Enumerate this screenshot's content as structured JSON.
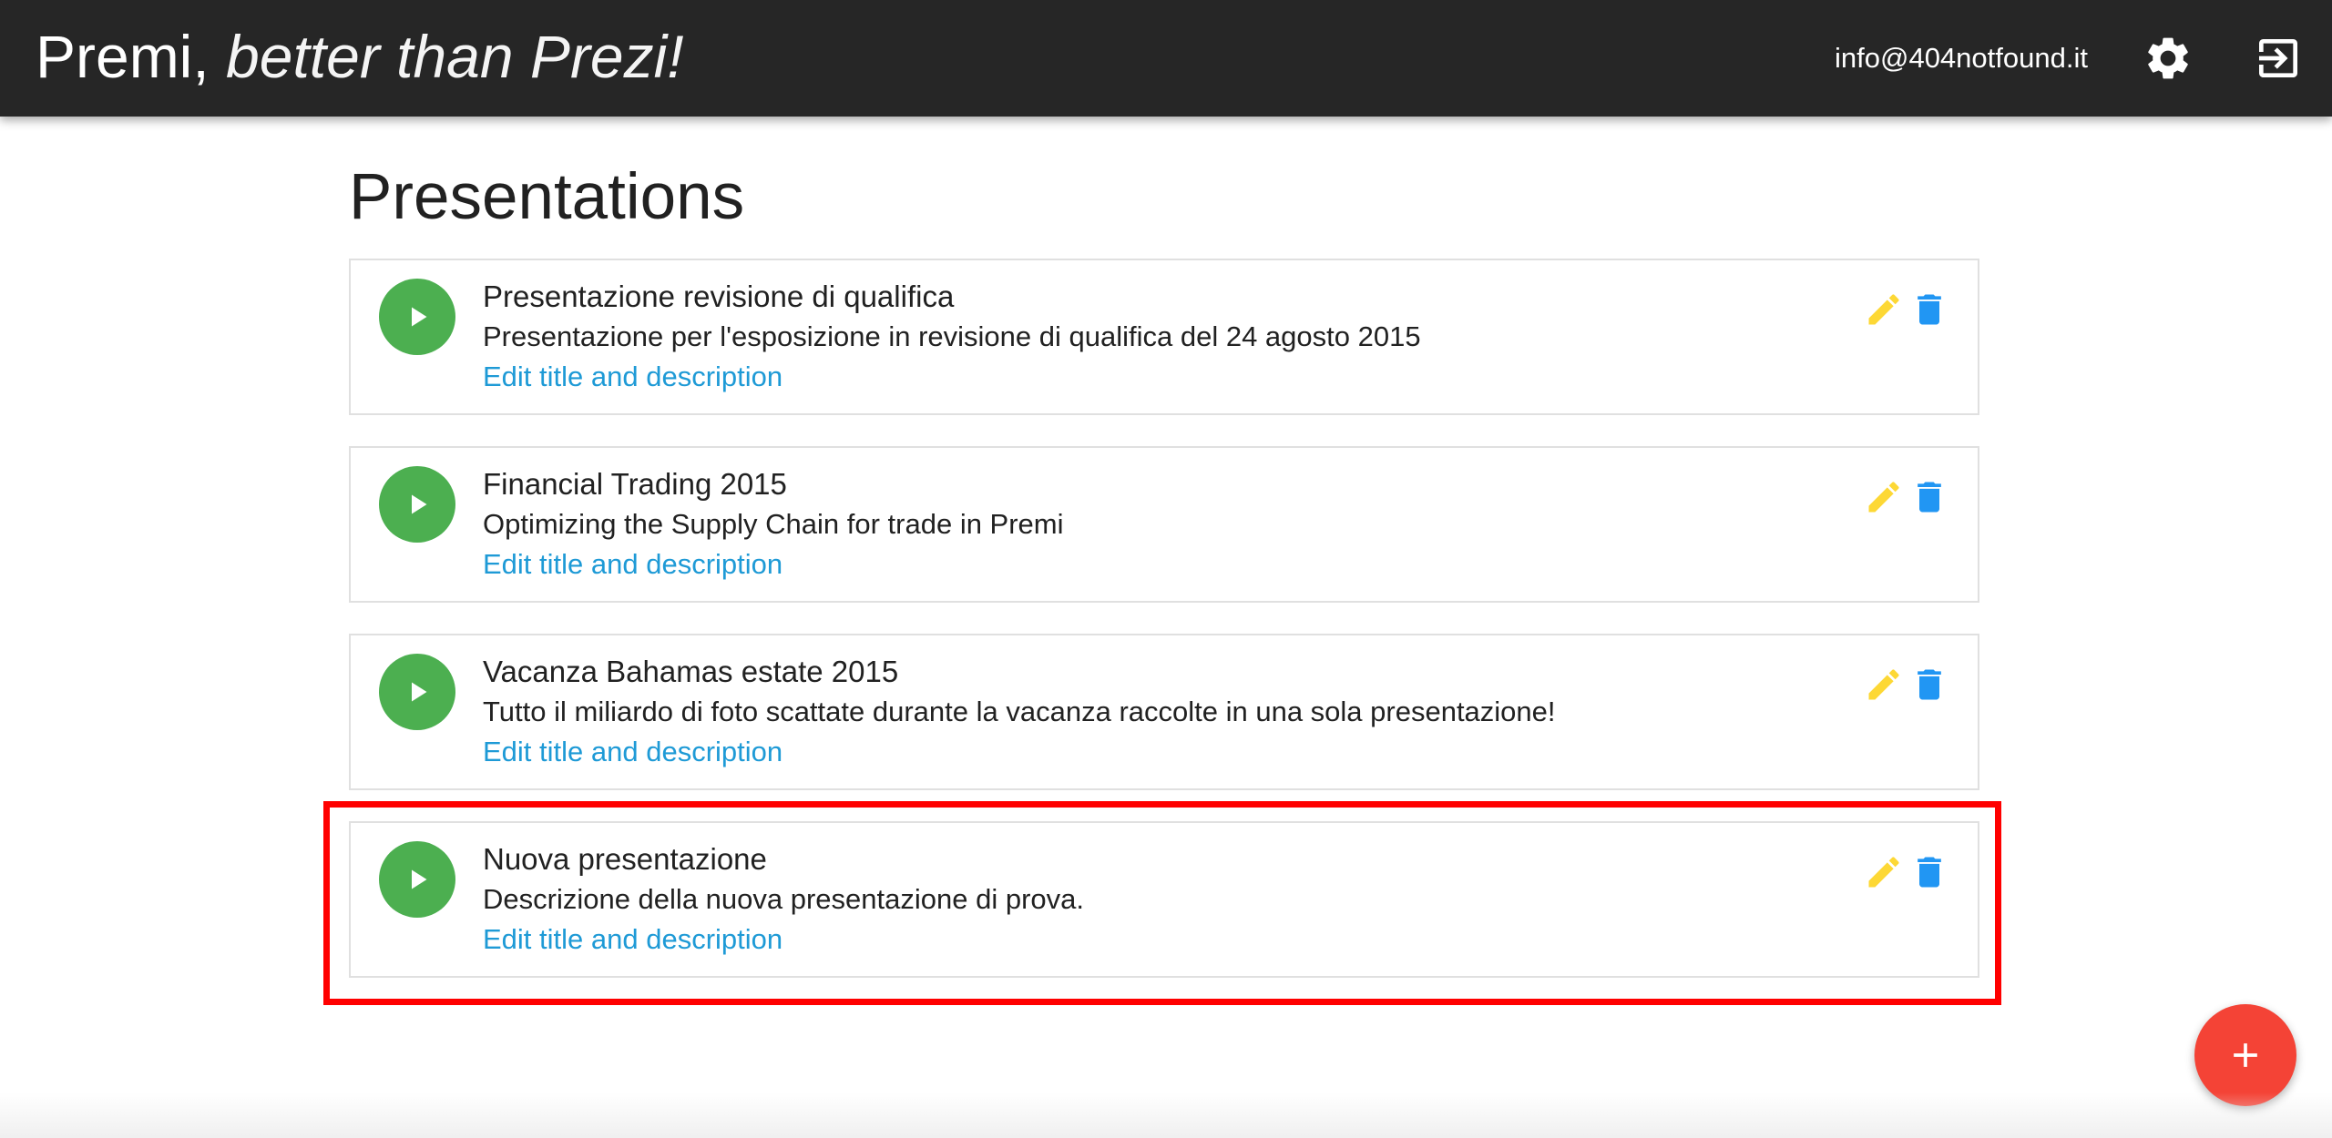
{
  "header": {
    "brand_name": "Premi,",
    "brand_tagline": "better than Prezi!",
    "user_email": "info@404notfound.it",
    "settings_icon": "gear-icon",
    "logout_icon": "logout-icon",
    "background_color": "#262626"
  },
  "main": {
    "title": "Presentations",
    "presentations": [
      {
        "title": "Presentazione revisione di qualifica",
        "description": "Presentazione per l'esposizione in revisione di qualifica del 24 agosto 2015",
        "edit_link": "Edit title and description"
      },
      {
        "title": "Financial Trading 2015",
        "description": "Optimizing the Supply Chain for trade in Premi",
        "edit_link": "Edit title and description"
      },
      {
        "title": "Vacanza Bahamas estate 2015",
        "description": "Tutto il miliardo di foto scattate durante la vacanza raccolte in una sola presentazione!",
        "edit_link": "Edit title and description"
      },
      {
        "title": "Nuova presentazione",
        "description": "Descrizione della nuova presentazione di prova.",
        "edit_link": "Edit title and description"
      }
    ]
  },
  "icons": {
    "play": "play-icon",
    "edit": "pencil-icon",
    "delete": "trash-icon",
    "add": "plus-icon"
  },
  "colors": {
    "play_button": "#4caf50",
    "edit_icon": "#fdd835",
    "delete_icon": "#2196f3",
    "link": "#1e9ad6",
    "fab": "#f44336",
    "highlight": "#ff0000"
  }
}
